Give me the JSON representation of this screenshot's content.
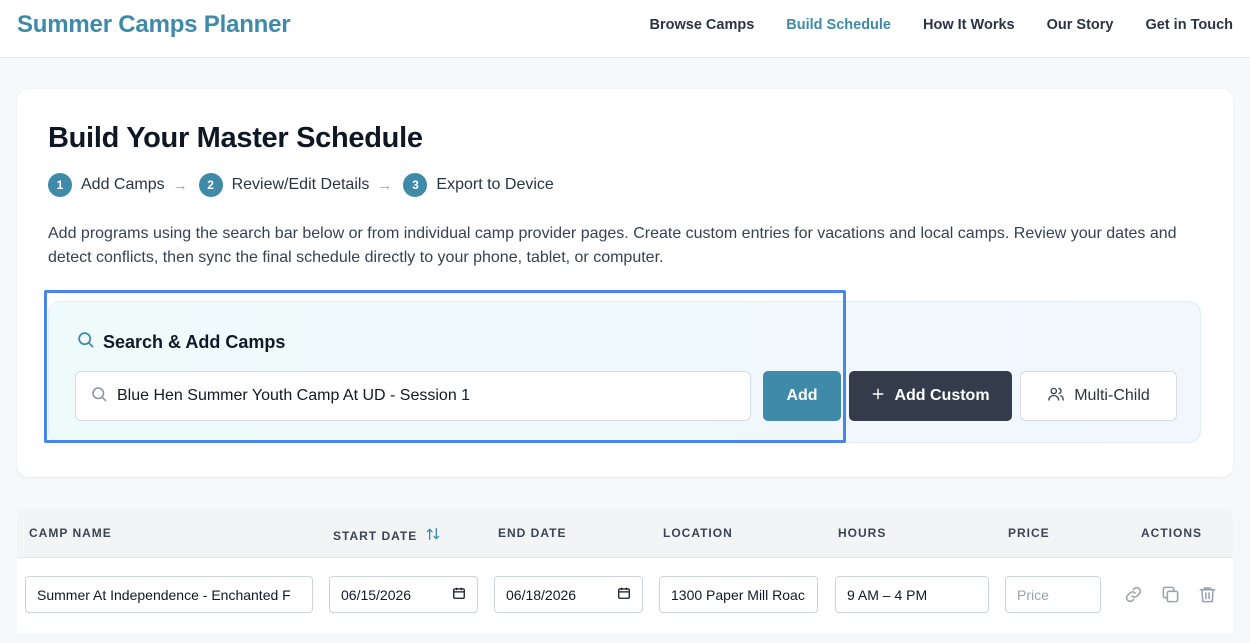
{
  "app": {
    "brand": "Summer Camps Planner"
  },
  "nav": [
    {
      "label": "Browse Camps",
      "active": false
    },
    {
      "label": "Build Schedule",
      "active": true
    },
    {
      "label": "How It Works",
      "active": false
    },
    {
      "label": "Our Story",
      "active": false
    },
    {
      "label": "Get in Touch",
      "active": false
    }
  ],
  "page": {
    "title": "Build Your Master Schedule",
    "steps": [
      {
        "num": "1",
        "label": "Add Camps"
      },
      {
        "num": "2",
        "label": "Review/Edit Details"
      },
      {
        "num": "3",
        "label": "Export to Device"
      }
    ],
    "description": "Add programs using the search bar below or from individual camp provider pages. Create custom entries for vacations and local camps. Review your dates and detect conflicts, then sync the final schedule directly to your phone, tablet, or computer."
  },
  "search": {
    "title": "Search & Add Camps",
    "value": "Blue Hen Summer Youth Camp At UD - Session 1",
    "add_label": "Add",
    "custom_label": "Add Custom",
    "multi_label": "Multi-Child"
  },
  "table": {
    "columns": {
      "name": "Camp Name",
      "start": "Start Date",
      "end": "End Date",
      "location": "Location",
      "hours": "Hours",
      "price": "Price",
      "actions": "Actions"
    },
    "rows": [
      {
        "name": "Summer At Independence - Enchanted F",
        "start": "06/15/2026",
        "end": "06/18/2026",
        "location": "1300 Paper Mill Roac",
        "hours": "9 AM – 4 PM",
        "price_placeholder": "Price"
      }
    ]
  },
  "colors": {
    "accent": "#3e8aa8",
    "dark_button": "#343b4a",
    "highlight": "#4a86e8"
  },
  "icons": [
    "search-icon",
    "plus-icon",
    "users-icon",
    "sort-icon",
    "calendar-icon",
    "link-icon",
    "copy-icon",
    "trash-icon",
    "arrow-right-icon"
  ]
}
